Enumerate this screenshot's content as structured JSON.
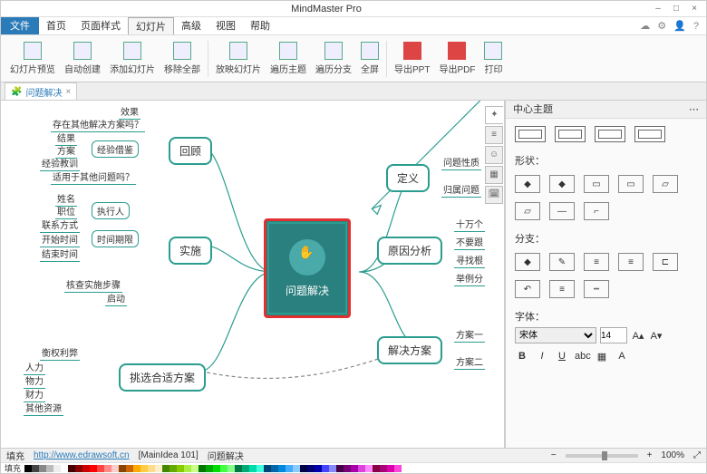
{
  "app_title": "MindMaster Pro",
  "menu": {
    "file": "文件",
    "tabs": [
      "首页",
      "页面样式",
      "幻灯片",
      "高级",
      "视图",
      "帮助"
    ],
    "active": 2
  },
  "ribbon": [
    {
      "label": "幻灯片预览"
    },
    {
      "label": "自动创建"
    },
    {
      "label": "添加幻灯片"
    },
    {
      "label": "移除全部"
    },
    {
      "label": "放映幻灯片"
    },
    {
      "label": "遍历主题"
    },
    {
      "label": "遍历分支"
    },
    {
      "label": "全屏"
    },
    {
      "label": "导出PPT"
    },
    {
      "label": "导出PDF"
    },
    {
      "label": "打印"
    }
  ],
  "doc_tab": {
    "title": "问题解决"
  },
  "sidepanel": {
    "title": "中心主题",
    "groups": {
      "shape": "形状：",
      "branch": "分支：",
      "font": "字体："
    },
    "font_name": "宋体",
    "font_size": "14"
  },
  "mindmap": {
    "center": "问题解决",
    "left_branches": [
      {
        "node": "回顾",
        "leaves": [
          "效果",
          "存在其他解决方案吗？",
          "结果",
          "方案",
          "经验借鉴",
          "经验教训",
          "适用于其他问题吗？"
        ]
      },
      {
        "node": "实施",
        "leaves": [
          "姓名",
          "职位",
          "执行人",
          "联系方式",
          "开始时间",
          "时间期限",
          "结束时间",
          "核查实施步骤",
          "启动"
        ]
      },
      {
        "node": "挑选合适方案",
        "leaves": [
          "衡权利弊",
          "人力",
          "物力",
          "财力",
          "其他资源"
        ]
      }
    ],
    "right_branches": [
      {
        "node": "定义",
        "leaves": [
          "问题性质",
          "归属问题"
        ]
      },
      {
        "node": "原因分析",
        "leaves": [
          "十万个",
          "不要跟",
          "寻找根",
          "举例分"
        ]
      },
      {
        "node": "解决方案",
        "leaves": [
          "方案一",
          "方案二"
        ]
      }
    ]
  },
  "status": {
    "fill": "填充",
    "url": "http://www.edrawsoft.cn",
    "context": "[MainIdea 101]",
    "doc": "问题解决",
    "zoom": "100%"
  },
  "swatches": [
    "#000",
    "#444",
    "#888",
    "#bbb",
    "#eee",
    "#fff",
    "#400",
    "#800",
    "#c00",
    "#f00",
    "#f44",
    "#f88",
    "#fcc",
    "#840",
    "#c60",
    "#fa0",
    "#fc4",
    "#fd8",
    "#fec",
    "#480",
    "#6a0",
    "#8c0",
    "#ae4",
    "#cf8",
    "#070",
    "#0a0",
    "#0d0",
    "#4f4",
    "#8f8",
    "#074",
    "#0a7",
    "#0da",
    "#4fd",
    "#047",
    "#06a",
    "#08d",
    "#4af",
    "#8cf",
    "#004",
    "#007",
    "#00a",
    "#44f",
    "#88f",
    "#404",
    "#707",
    "#a0a",
    "#d4d",
    "#f8f",
    "#804",
    "#a07",
    "#d0a",
    "#f4d"
  ]
}
